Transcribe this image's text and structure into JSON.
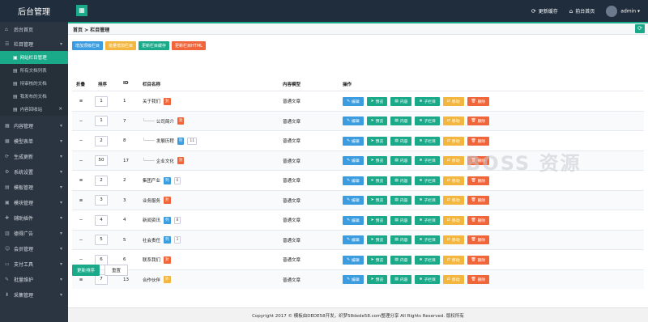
{
  "topbar": {
    "brand": "后台管理",
    "toggle_icon": "menu-grid-icon",
    "update_cache": "更新缓存",
    "home": "前台首页",
    "user": "admin"
  },
  "sidebar": {
    "items": [
      {
        "label": "后台首页",
        "icon": "home-icon"
      },
      {
        "label": "栏目管理",
        "icon": "list-icon"
      },
      {
        "label": "内容管理",
        "icon": "file-icon"
      },
      {
        "label": "模型表单",
        "icon": "form-icon"
      },
      {
        "label": "生成更新",
        "icon": "refresh-icon"
      },
      {
        "label": "系统设置",
        "icon": "gear-icon"
      },
      {
        "label": "模板管理",
        "icon": "template-icon"
      },
      {
        "label": "模块管理",
        "icon": "module-icon"
      },
      {
        "label": "辅助插件",
        "icon": "plugin-icon"
      },
      {
        "label": "德得广告",
        "icon": "ad-icon"
      },
      {
        "label": "会员管理",
        "icon": "user-icon"
      },
      {
        "label": "支付工具",
        "icon": "pay-icon"
      },
      {
        "label": "批量维护",
        "icon": "batch-icon"
      },
      {
        "label": "采集管理",
        "icon": "collect-icon"
      }
    ],
    "sub_items": [
      {
        "label": "网站栏目管理"
      },
      {
        "label": "所有文档列表"
      },
      {
        "label": "待审核的文档"
      },
      {
        "label": "我发布的文档"
      },
      {
        "label": "内容回收站"
      }
    ]
  },
  "breadcrumb": "首页 > 栏目管理",
  "toolbar": {
    "add_top": "增加顶级栏目",
    "batch_add": "批量增加栏目",
    "update_cache": "更新栏目缓存",
    "update_html": "更新栏目HTML"
  },
  "table": {
    "headers": {
      "fold": "折叠",
      "sort": "排序",
      "id": "ID",
      "name": "栏目名称",
      "model": "内容模型",
      "ops": "操作"
    },
    "op_labels": {
      "edit": "编辑",
      "preview": "预览",
      "content": "内容",
      "sub": "子栏目",
      "move": "移动",
      "delete": "删除"
    },
    "rows": [
      {
        "fold": "≡",
        "sort": "1",
        "id": "1",
        "name": "关于我们",
        "tree": "",
        "badge": "封",
        "badge_color": "o",
        "count": "",
        "model": "普通文章"
      },
      {
        "fold": "−",
        "sort": "1",
        "id": "7",
        "name": "公司简介",
        "tree": "└─────",
        "badge": "封",
        "badge_color": "o",
        "count": "",
        "model": "普通文章"
      },
      {
        "fold": "−",
        "sort": "2",
        "id": "8",
        "name": "发展历程",
        "tree": "└─────",
        "badge": "列",
        "badge_color": "b",
        "count": "11",
        "model": "普通文章"
      },
      {
        "fold": "−",
        "sort": "50",
        "id": "17",
        "name": "企业文化",
        "tree": "└─────",
        "badge": "封",
        "badge_color": "o",
        "count": "",
        "model": "普通文章"
      },
      {
        "fold": "≡",
        "sort": "2",
        "id": "2",
        "name": "集团产业",
        "tree": "",
        "badge": "列",
        "badge_color": "b",
        "count": "0",
        "model": "普通文章"
      },
      {
        "fold": "≡",
        "sort": "3",
        "id": "3",
        "name": "业务服务",
        "tree": "",
        "badge": "封",
        "badge_color": "o",
        "count": "",
        "model": "普通文章"
      },
      {
        "fold": "−",
        "sort": "4",
        "id": "4",
        "name": "新闻资讯",
        "tree": "",
        "badge": "列",
        "badge_color": "b",
        "count": "8",
        "model": "普通文章"
      },
      {
        "fold": "−",
        "sort": "5",
        "id": "5",
        "name": "社会责任",
        "tree": "",
        "badge": "列",
        "badge_color": "b",
        "count": "3",
        "model": "普通文章"
      },
      {
        "fold": "−",
        "sort": "6",
        "id": "6",
        "name": "联系我们",
        "tree": "",
        "badge": "封",
        "badge_color": "o",
        "count": "",
        "model": "普通文章"
      },
      {
        "fold": "≡",
        "sort": "7",
        "id": "13",
        "name": "合作伙伴",
        "tree": "",
        "badge": "外",
        "badge_color": "y",
        "count": "",
        "model": "普通文章"
      }
    ]
  },
  "bottom": {
    "save": "更新排序",
    "reset": "重置"
  },
  "footer": "Copyright 2017 © 模板由DEDE58开发，织梦58dede58.com整理分享 All Rights Reserved. 版权所有",
  "watermark": "BOSS 资源",
  "colors": {
    "primary": "#1aaa8a",
    "blue": "#3b9de0",
    "yellow": "#f3b73f",
    "red": "#f0663a",
    "dark": "#1f2d3d"
  }
}
